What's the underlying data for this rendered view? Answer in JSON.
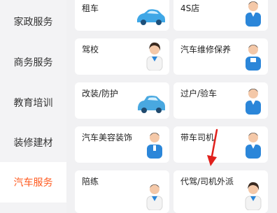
{
  "sidebar": {
    "items": [
      {
        "label": "家政服务",
        "active": false
      },
      {
        "label": "商务服务",
        "active": false
      },
      {
        "label": "教育培训",
        "active": false
      },
      {
        "label": "装修建材",
        "active": false
      },
      {
        "label": "汽车服务",
        "active": true
      }
    ],
    "active_color": "#ff5a1f"
  },
  "services": [
    {
      "label": "租车",
      "icon": "car-icon"
    },
    {
      "label": "4S店",
      "icon": "staff-icon"
    },
    {
      "label": "驾校",
      "icon": "staff-icon"
    },
    {
      "label": "汽车维修保养",
      "icon": "staff-icon"
    },
    {
      "label": "改装/防护",
      "icon": "car-icon"
    },
    {
      "label": "过户/验车",
      "icon": "staff-icon"
    },
    {
      "label": "汽车美容装饰",
      "icon": "staff-icon"
    },
    {
      "label": "带车司机",
      "icon": "staff-icon"
    },
    {
      "label": "陪练",
      "icon": "staff-icon"
    },
    {
      "label": "代驾/司机外派",
      "icon": "staff-icon"
    }
  ],
  "annotation": {
    "color": "#e0201c",
    "icon": "red-arrow-icon"
  }
}
